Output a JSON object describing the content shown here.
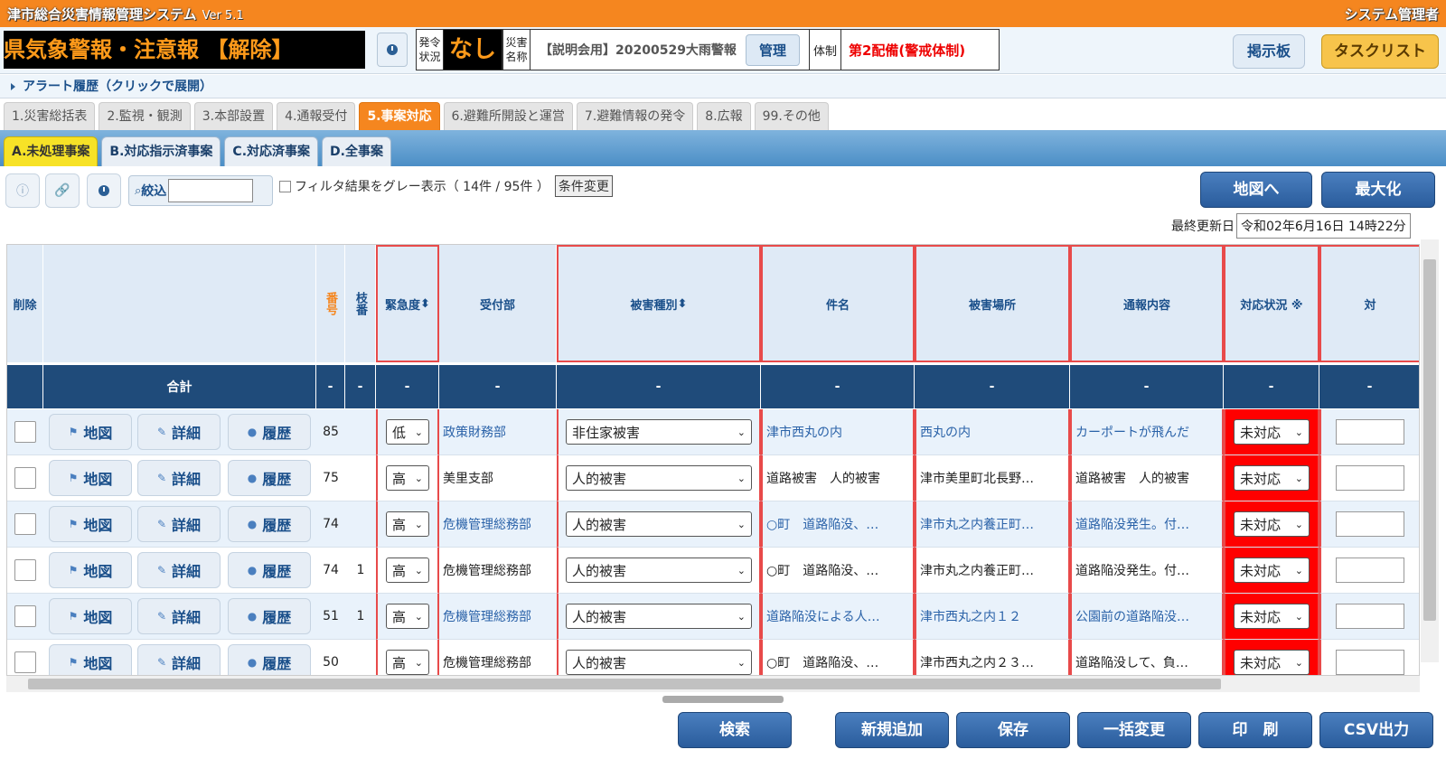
{
  "app": {
    "title": "津市総合災害情報管理システム",
    "version": "Ver 5.1",
    "user": "システム管理者"
  },
  "status": {
    "ticker": "県気象警報・注意報 【解除】",
    "hatsurei_label": "発令状況",
    "hatsurei_value": "なし",
    "saigai_label": "災害名称",
    "saigai_name": "【説明会用】20200529大雨警報",
    "kanri_label": "管理",
    "taisei_label": "体制",
    "taisei_value": "第2配備(警戒体制)",
    "board_label": "掲示板",
    "task_label": "タスクリスト"
  },
  "alert_history": "アラート履歴（クリックで展開）",
  "main_tabs": [
    "1.災害総括表",
    "2.監視・観測",
    "3.本部設置",
    "4.通報受付",
    "5.事案対応",
    "6.避難所開設と運営",
    "7.避難情報の発令",
    "8.広報",
    "99.その他"
  ],
  "main_tab_active": 4,
  "sub_tabs": [
    "A.未処理事案",
    "B.対応指示済事案",
    "C.対応済事案",
    "D.全事案"
  ],
  "toolbar": {
    "filter_label": "絞込",
    "filter_value": "",
    "gray_label": "フィルタ結果をグレー表示（ 14件 / 95件 ）",
    "cond_button": "条件変更",
    "map_button": "地図へ",
    "maximize_button": "最大化",
    "last_update_label": "最終更新日",
    "last_update_value": "令和02年6月16日 14時22分"
  },
  "table": {
    "headers": {
      "delete": "削除",
      "number": "番号",
      "branch": "枝番",
      "urgency": "緊急度",
      "dept": "受付部",
      "damage_type": "被害種別",
      "title": "件名",
      "place": "被害場所",
      "report": "通報内容",
      "status": "対応状況 ※",
      "next": "対"
    },
    "sum_label": "合計",
    "dash": "-",
    "buttons": {
      "map": "地図",
      "detail": "詳細",
      "history": "履歴"
    },
    "rows": [
      {
        "no": "85",
        "branch": "",
        "urgency": "低",
        "dept": "政策財務部",
        "type": "非住家被害",
        "title": "津市西丸の内",
        "place": "西丸の内",
        "report": "カーポートが飛んだ",
        "status": "未対応"
      },
      {
        "no": "75",
        "branch": "",
        "urgency": "高",
        "dept": "美里支部",
        "type": "人的被害",
        "title": "道路被害　人的被害",
        "place": "津市美里町北長野…",
        "report": "道路被害　人的被害",
        "status": "未対応"
      },
      {
        "no": "74",
        "branch": "",
        "urgency": "高",
        "dept": "危機管理総務部",
        "type": "人的被害",
        "title": "○町　道路陥没、…",
        "place": "津市丸之内養正町…",
        "report": "道路陥没発生。付…",
        "status": "未対応"
      },
      {
        "no": "74",
        "branch": "1",
        "urgency": "高",
        "dept": "危機管理総務部",
        "type": "人的被害",
        "title": "○町　道路陥没、…",
        "place": "津市丸之内養正町…",
        "report": "道路陥没発生。付…",
        "status": "未対応"
      },
      {
        "no": "51",
        "branch": "1",
        "urgency": "高",
        "dept": "危機管理総務部",
        "type": "人的被害",
        "title": "道路陥没による人…",
        "place": "津市西丸之内１２",
        "report": "公園前の道路陥没…",
        "status": "未対応"
      },
      {
        "no": "50",
        "branch": "",
        "urgency": "高",
        "dept": "危機管理総務部",
        "type": "人的被害",
        "title": "○町　道路陥没、…",
        "place": "津市西丸之内２３…",
        "report": "道路陥没して、負…",
        "status": "未対応"
      }
    ]
  },
  "bottom": {
    "search": "検索",
    "add": "新規追加",
    "save": "保存",
    "bulk": "一括変更",
    "print": "印　刷",
    "csv": "CSV出力"
  }
}
